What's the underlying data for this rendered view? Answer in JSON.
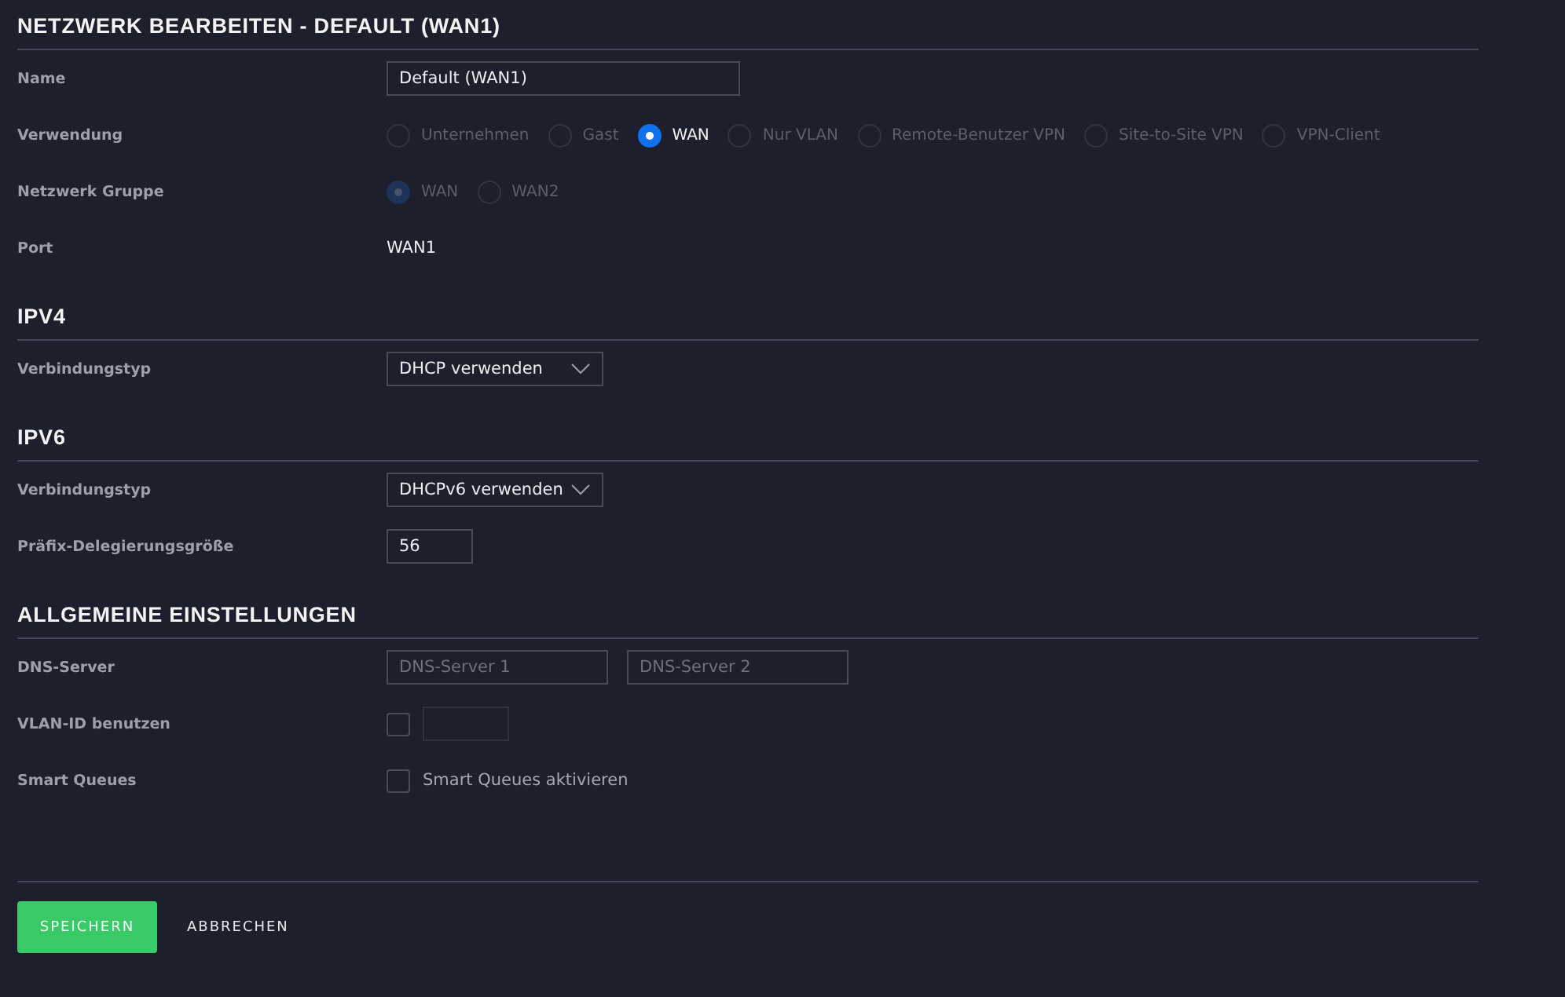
{
  "sections": [
    {
      "heading": "NETZWERK BEARBEITEN - DEFAULT (WAN1)",
      "rows": [
        {
          "kind": "text",
          "label": "Name",
          "value": "Default (WAN1)"
        },
        {
          "kind": "radio",
          "label": "Verwendung",
          "options": [
            {
              "label": "Unternehmen",
              "selected": false,
              "disabled": true
            },
            {
              "label": "Gast",
              "selected": false,
              "disabled": true
            },
            {
              "label": "WAN",
              "selected": true,
              "disabled": false
            },
            {
              "label": "Nur VLAN",
              "selected": false,
              "disabled": true
            },
            {
              "label": "Remote-Benutzer VPN",
              "selected": false,
              "disabled": true
            },
            {
              "label": "Site-to-Site VPN",
              "selected": false,
              "disabled": true
            },
            {
              "label": "VPN-Client",
              "selected": false,
              "disabled": true
            }
          ]
        },
        {
          "kind": "radio",
          "label": "Netzwerk Gruppe",
          "options": [
            {
              "label": "WAN",
              "selected": true,
              "disabled": true
            },
            {
              "label": "WAN2",
              "selected": false,
              "disabled": true
            }
          ]
        },
        {
          "kind": "static",
          "label": "Port",
          "value": "WAN1"
        }
      ]
    },
    {
      "heading": "IPV4",
      "rows": [
        {
          "kind": "select",
          "label": "Verbindungstyp",
          "value": "DHCP verwenden"
        }
      ]
    },
    {
      "heading": "IPV6",
      "rows": [
        {
          "kind": "select",
          "label": "Verbindungstyp",
          "value": "DHCPv6 verwenden"
        },
        {
          "kind": "number",
          "label": "Präfix-Delegierungsgröße",
          "value": "56"
        }
      ]
    },
    {
      "heading": "ALLGEMEINE EINSTELLUNGEN",
      "rows": [
        {
          "kind": "multi_text",
          "label": "DNS-Server",
          "fields": [
            {
              "placeholder": "DNS-Server 1"
            },
            {
              "placeholder": "DNS-Server 2"
            }
          ]
        },
        {
          "kind": "checkbox_field",
          "label": "VLAN-ID benutzen",
          "checked": false
        },
        {
          "kind": "checkbox",
          "label": "Smart Queues",
          "checked": false,
          "text": "Smart Queues aktivieren"
        }
      ]
    }
  ],
  "buttons": [
    {
      "label": "SPEICHERN",
      "kind": "primary"
    },
    {
      "label": "ABBRECHEN",
      "kind": "link"
    }
  ]
}
